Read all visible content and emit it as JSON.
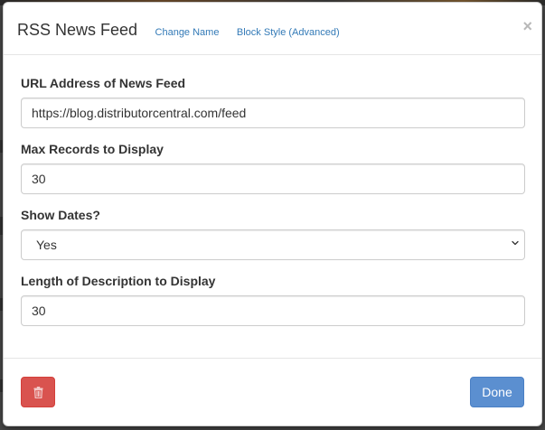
{
  "modal": {
    "title": "RSS News Feed",
    "links": {
      "change_name": "Change Name",
      "block_style": "Block Style (Advanced)"
    },
    "close_glyph": "×"
  },
  "form": {
    "url": {
      "label": "URL Address of News Feed",
      "value": "https://blog.distributorcentral.com/feed"
    },
    "max_records": {
      "label": "Max Records to Display",
      "value": "30"
    },
    "show_dates": {
      "label": "Show Dates?",
      "value": "Yes"
    },
    "description_length": {
      "label": "Length of Description to Display",
      "value": "30"
    }
  },
  "footer": {
    "delete_icon": "trash-icon",
    "done_label": "Done"
  },
  "colors": {
    "link": "#337ab7",
    "danger": "#d9534f",
    "primary": "#5b8fd0"
  }
}
